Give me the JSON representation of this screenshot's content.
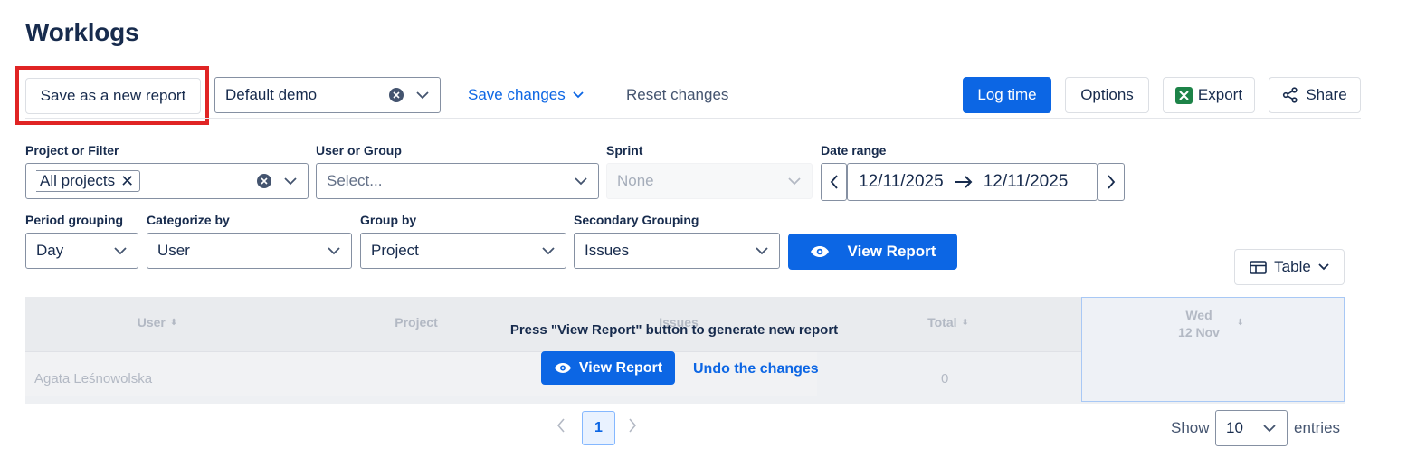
{
  "page": {
    "title": "Worklogs"
  },
  "toolbar": {
    "save_new_report": "Save as a new report",
    "report_select_value": "Default demo",
    "save_changes": "Save changes",
    "reset_changes": "Reset changes",
    "log_time": "Log time",
    "options": "Options",
    "export": "Export",
    "share": "Share"
  },
  "filters": {
    "project_label": "Project or Filter",
    "project_tag": "All projects",
    "user_label": "User or Group",
    "user_placeholder": "Select...",
    "sprint_label": "Sprint",
    "sprint_value": "None",
    "date_label": "Date range",
    "date_from": "12/11/2025",
    "date_to": "12/11/2025",
    "period_label": "Period grouping",
    "period_value": "Day",
    "categorize_label": "Categorize by",
    "categorize_value": "User",
    "groupby_label": "Group by",
    "groupby_value": "Project",
    "secondary_label": "Secondary Grouping",
    "secondary_value": "Issues",
    "view_report": "View Report"
  },
  "view_toggle": {
    "label": "Table"
  },
  "table": {
    "headers": [
      "User",
      "Project",
      "Issues",
      "Total"
    ],
    "date_header_day": "Wed",
    "date_header_date": "12 Nov",
    "row_user": "Agata Leśnowolska",
    "row_total": "0"
  },
  "overlay": {
    "message": "Press \"View Report\" button to generate new report",
    "view_report": "View Report",
    "undo": "Undo the changes"
  },
  "pagination": {
    "current_page": "1",
    "show_label": "Show",
    "page_size": "10",
    "entries_label": "entries"
  },
  "colors": {
    "accent": "#0c66e4",
    "highlight": "#e02424",
    "excel_green": "#1d8348"
  }
}
